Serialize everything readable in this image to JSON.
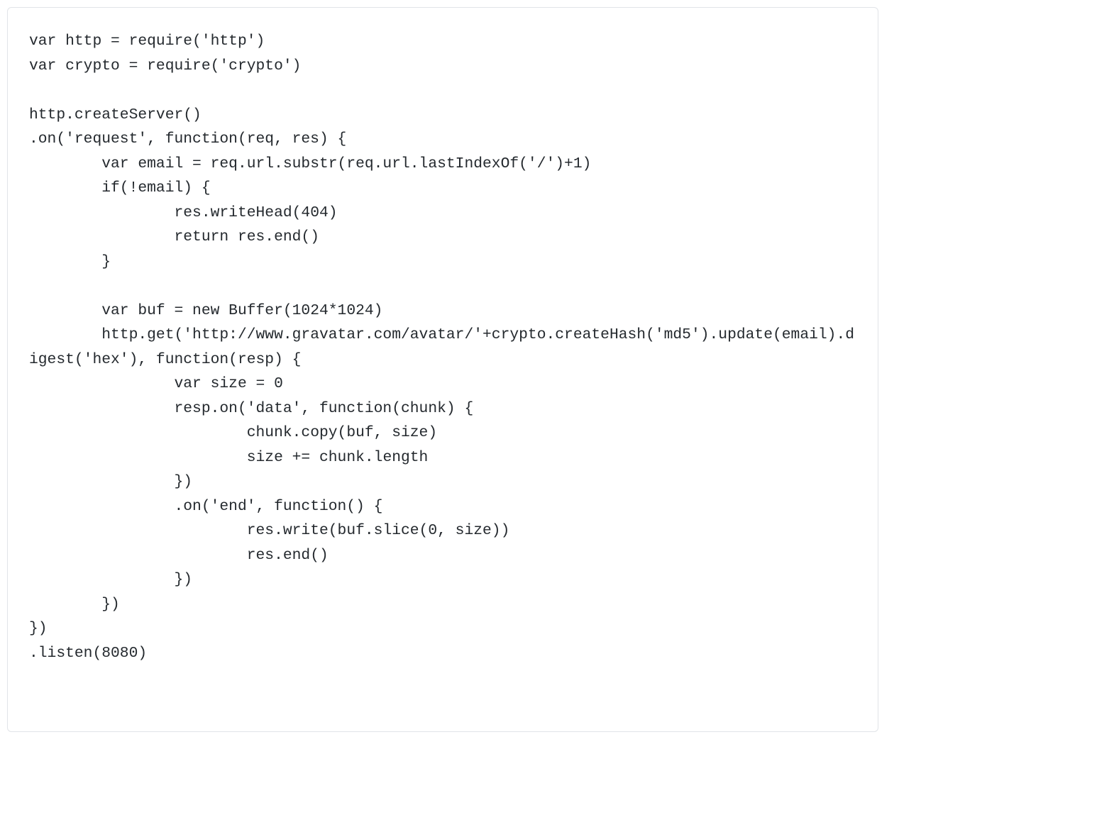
{
  "code": {
    "lines": [
      "var http = require('http')",
      "var crypto = require('crypto')",
      "",
      "http.createServer()",
      ".on('request', function(req, res) {",
      "        var email = req.url.substr(req.url.lastIndexOf('/')+1)",
      "        if(!email) {",
      "                res.writeHead(404)",
      "                return res.end()",
      "        }",
      "",
      "        var buf = new Buffer(1024*1024)",
      "        http.get('http://www.gravatar.com/avatar/'+crypto.createHash('md5').update(email).digest('hex'), function(resp) {",
      "                var size = 0",
      "                resp.on('data', function(chunk) {",
      "                        chunk.copy(buf, size)",
      "                        size += chunk.length",
      "                })",
      "                .on('end', function() {",
      "                        res.write(buf.slice(0, size))",
      "                        res.end()",
      "                })",
      "        })",
      "})",
      ".listen(8080)"
    ]
  }
}
